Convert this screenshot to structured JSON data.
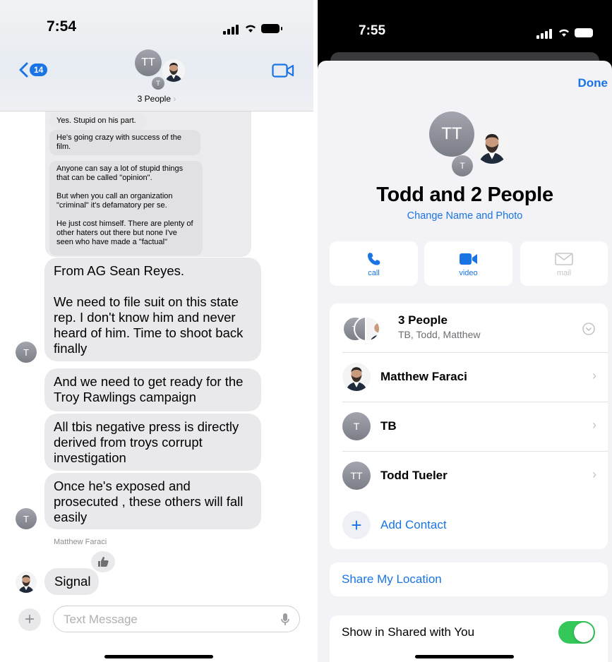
{
  "left": {
    "status": {
      "time": "7:54"
    },
    "header": {
      "back_count": "14",
      "group_initials": "TT",
      "member_initial": "T",
      "title": "3 People",
      "title_chevron": "›"
    },
    "messages": {
      "m1": "Yes. Stupid on his part.",
      "m2": "He's going crazy with success of the film.",
      "m3": "Anyone can say a lot of stupid things that can be called \"opinion\".\n\nBut when you call an organization \"criminal\" it's defamatory per se.\n\nHe just cost himself. There are plenty of other haters out there but none I've seen who have made a \"factual\"",
      "m4": "From AG Sean Reyes.\n\nWe need to file suit on this state rep. I don't know him and never heard of him. Time to shoot back finally",
      "m5": "And we need to get ready for the Troy Rawlings campaign",
      "m6": "All tbis negative press is directly derived from troys corrupt investigation",
      "m7": "Once  he's exposed and prosecuted , these others will fall easily",
      "sender_label": "Matthew Faraci",
      "m8": "Signal",
      "sender_avatar_initial": "T"
    },
    "composer": {
      "placeholder": "Text Message",
      "plus": "+"
    }
  },
  "right": {
    "status": {
      "time": "7:55"
    },
    "done": "Done",
    "avatar_initials": "TT",
    "avatar_small": "T",
    "group_name": "Todd and 2 People",
    "change_name": "Change Name and Photo",
    "actions": [
      {
        "label": "call",
        "icon": "phone-icon"
      },
      {
        "label": "video",
        "icon": "video-icon"
      },
      {
        "label": "mail",
        "icon": "mail-icon"
      }
    ],
    "members_summary": {
      "title": "3 People",
      "subtitle": "TB, Todd, Matthew",
      "initial": "T"
    },
    "members": [
      {
        "name": "Matthew Faraci",
        "initials": ""
      },
      {
        "name": "TB",
        "initials": "T"
      },
      {
        "name": "Todd Tueler",
        "initials": "TT"
      }
    ],
    "add_contact": "Add Contact",
    "share_location": "Share My Location",
    "shared_with_you": "Show in Shared with You",
    "toggle_on": true,
    "colors": {
      "accent": "#1a74e4",
      "toggle": "#34c759"
    }
  }
}
